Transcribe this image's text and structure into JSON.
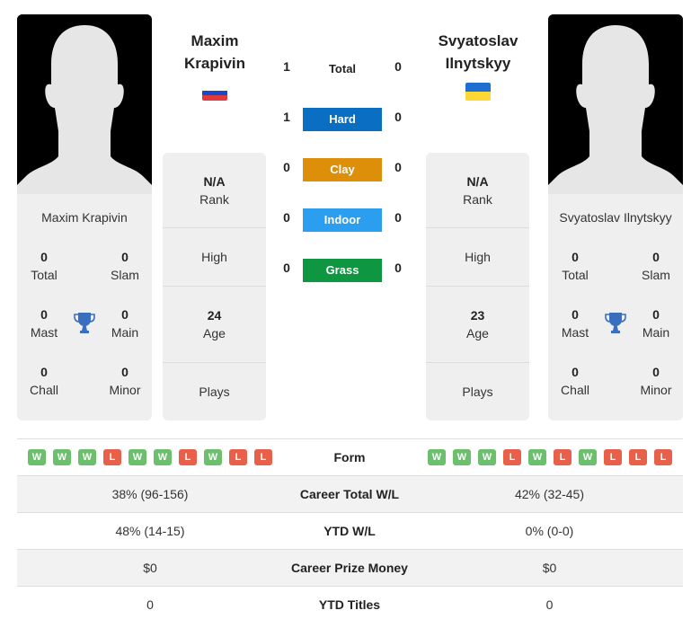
{
  "player1": {
    "name_line1": "Maxim",
    "name_line2": "Krapivin",
    "full_name": "Maxim Krapivin",
    "flag": "russia-flag",
    "flag_colors": [
      "#ffffff",
      "#1c48c4",
      "#e03a3e"
    ],
    "stats": {
      "total": {
        "value": "0",
        "label": "Total"
      },
      "slam": {
        "value": "0",
        "label": "Slam"
      },
      "mast": {
        "value": "0",
        "label": "Mast"
      },
      "main": {
        "value": "0",
        "label": "Main"
      },
      "chall": {
        "value": "0",
        "label": "Chall"
      },
      "minor": {
        "value": "0",
        "label": "Minor"
      }
    },
    "rank": {
      "value": "N/A",
      "label": "Rank"
    },
    "high": {
      "label": "High"
    },
    "age": {
      "value": "24",
      "label": "Age"
    },
    "plays": {
      "label": "Plays"
    },
    "form": [
      "W",
      "W",
      "W",
      "L",
      "W",
      "W",
      "L",
      "W",
      "L",
      "L"
    ]
  },
  "player2": {
    "name_line1": "Svyatoslav",
    "name_line2": "Ilnytskyy",
    "full_name": "Svyatoslav Ilnytskyy",
    "flag": "ukraine-flag",
    "flag_colors": [
      "#1f6fd1",
      "#fdd835"
    ],
    "stats": {
      "total": {
        "value": "0",
        "label": "Total"
      },
      "slam": {
        "value": "0",
        "label": "Slam"
      },
      "mast": {
        "value": "0",
        "label": "Mast"
      },
      "main": {
        "value": "0",
        "label": "Main"
      },
      "chall": {
        "value": "0",
        "label": "Chall"
      },
      "minor": {
        "value": "0",
        "label": "Minor"
      }
    },
    "rank": {
      "value": "N/A",
      "label": "Rank"
    },
    "high": {
      "label": "High"
    },
    "age": {
      "value": "23",
      "label": "Age"
    },
    "plays": {
      "label": "Plays"
    },
    "form": [
      "W",
      "W",
      "W",
      "L",
      "W",
      "L",
      "W",
      "L",
      "L",
      "L"
    ]
  },
  "h2h": {
    "total": {
      "label": "Total",
      "p1": "1",
      "p2": "0"
    },
    "surfaces": [
      {
        "label": "Hard",
        "p1": "1",
        "p2": "0",
        "color": "#0a6fc2"
      },
      {
        "label": "Clay",
        "p1": "0",
        "p2": "0",
        "color": "#de8f09"
      },
      {
        "label": "Indoor",
        "p1": "0",
        "p2": "0",
        "color": "#2c9ef0"
      },
      {
        "label": "Grass",
        "p1": "0",
        "p2": "0",
        "color": "#0f9640"
      }
    ]
  },
  "comparison": {
    "form_label": "Form",
    "rows": [
      {
        "label": "Career Total W/L",
        "p1": "38% (96-156)",
        "p2": "42% (32-45)"
      },
      {
        "label": "YTD W/L",
        "p1": "48% (14-15)",
        "p2": "0% (0-0)"
      },
      {
        "label": "Career Prize Money",
        "p1": "$0",
        "p2": "$0"
      },
      {
        "label": "YTD Titles",
        "p1": "0",
        "p2": "0"
      }
    ]
  },
  "colors": {
    "win": "#6cbf6c",
    "loss": "#e8604a",
    "trophy": "#3a6fc0",
    "card_bg": "#efefef"
  }
}
